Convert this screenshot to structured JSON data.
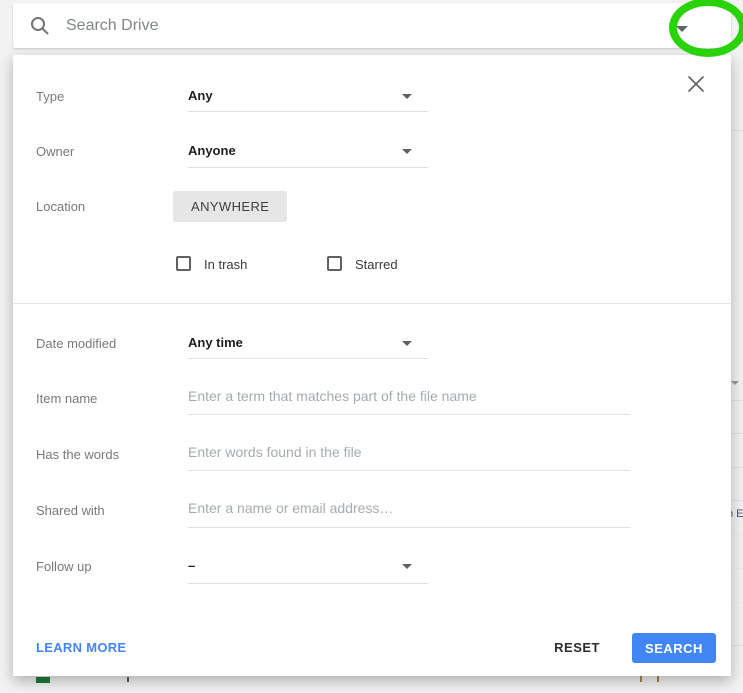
{
  "search_bar": {
    "placeholder": "Search Drive"
  },
  "annotation": {
    "shape": "ellipse-highlight-around-dropdown-caret",
    "color": "#2ad20a"
  },
  "panel": {
    "type_row": {
      "label": "Type",
      "value": "Any"
    },
    "owner_row": {
      "label": "Owner",
      "value": "Anyone"
    },
    "location_row": {
      "label": "Location",
      "button": "ANYWHERE"
    },
    "checkboxes": [
      {
        "label": "In trash",
        "checked": false
      },
      {
        "label": "Starred",
        "checked": false
      }
    ],
    "date_row": {
      "label": "Date modified",
      "value": "Any time"
    },
    "item_name_row": {
      "label": "Item name",
      "value": "",
      "placeholder": "Enter a term that matches part of the file name"
    },
    "has_words_row": {
      "label": "Has the words",
      "value": "",
      "placeholder": "Enter words found in the file"
    },
    "shared_with_row": {
      "label": "Shared with",
      "value": "",
      "placeholder": "Enter a name or email address…"
    },
    "follow_up_row": {
      "label": "Follow up",
      "value": "–"
    },
    "footer": {
      "learn_more": "LEARN MORE",
      "reset": "RESET",
      "search": "SEARCH"
    }
  },
  "background": {
    "partial_text": "o E"
  },
  "colors": {
    "accent_blue": "#4285f4",
    "annotation_green": "#2ad20a",
    "anywhere_button_bg": "#e6e6e6"
  }
}
